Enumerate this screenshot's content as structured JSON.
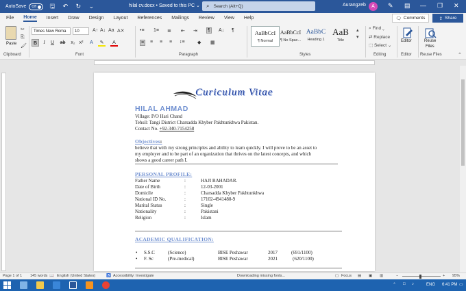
{
  "titlebar": {
    "autosave_label": "AutoSave",
    "autosave_state": "Off",
    "doc_title": "hilal cv.docx • Saved to this PC ⌄",
    "search_placeholder": "Search (Alt+Q)",
    "user_name": "Aurangzeb",
    "user_initial": "A",
    "accent": "#2b579a"
  },
  "tabs": [
    "File",
    "Home",
    "Insert",
    "Draw",
    "Design",
    "Layout",
    "References",
    "Mailings",
    "Review",
    "View",
    "Help"
  ],
  "active_tab": "Home",
  "actions": {
    "comments": "Comments",
    "share": "Share"
  },
  "ribbon": {
    "clipboard": {
      "paste": "Paste",
      "label": "Clipboard"
    },
    "font": {
      "name": "Times New Roma",
      "size": "10",
      "label": "Font"
    },
    "paragraph": {
      "label": "Paragraph"
    },
    "styles": {
      "label": "Styles",
      "items": [
        {
          "sample": "AaBbCcI",
          "name": "¶ Normal"
        },
        {
          "sample": "AaBbCcI",
          "name": "¶ No Spac..."
        },
        {
          "sample": "AaBbC",
          "name": "Heading 1"
        },
        {
          "sample": "AaB",
          "name": "Title"
        }
      ]
    },
    "editing": {
      "find": "Find",
      "replace": "Replace",
      "select": "Select",
      "label": "Editing"
    },
    "editor": {
      "button": "Editor",
      "label": "Editor"
    },
    "reuse": {
      "button_line1": "Reuse",
      "button_line2": "Files",
      "label": "Reuse Files"
    }
  },
  "document": {
    "heading_title": "Curiculum Vitae",
    "name": "HILAL AHMAD",
    "village": "Village: P/O Hari Chand",
    "tehsil": "Tehsil: Tangi District Charsadda Khyber Pakhtunkhwa Pakistan.",
    "contact_label": "Contact No. ",
    "contact_number": "+92-340-7154258",
    "objectives_heading": "Objectives",
    "objectives_colon": ":",
    "objectives_lines": [
      "believe that with my strong principles and ability to learn quickly. I will prove to be an asset to",
      "my employer and to be part of an organization that thrives on the latest concepts, and which",
      "shows a good career path I."
    ],
    "personal_heading": "PERSONAL PROFILE:",
    "personal": [
      {
        "label": "Father Name",
        "value": "HAJI BAHADAR."
      },
      {
        "label": "Date of Birth",
        "value": "12-03-2001"
      },
      {
        "label": "Domicile",
        "value": "Charsadda Khyber Pakhtunkhwa"
      },
      {
        "label": "National ID No.",
        "value": "17102-4941480-9"
      },
      {
        "label": "Marital Status",
        "value": "Single"
      },
      {
        "label": "Nationality",
        "value": "Pakistani"
      },
      {
        "label": "Religion",
        "value": "Islam"
      }
    ],
    "academic_heading": "ACADEMIC QUALIFICATION:",
    "academics": [
      {
        "degree": "S.S.C",
        "stream": "(Science)",
        "board": "BISE Peshawar",
        "year": "2017",
        "marks": "(691/1100)"
      },
      {
        "degree": "F. Sc",
        "stream": "(Pre-medical)",
        "board": "BISE Peshawar",
        "year": "2021",
        "marks": "(620/1100)"
      }
    ]
  },
  "statusbar": {
    "page": "Page 1 of 1",
    "words": "145 words",
    "language": "English (United States)",
    "accessibility": "Accessibility: Investigate",
    "downloading": "Downloading missing fonts...",
    "focus": "Focus",
    "zoom": "95%"
  },
  "taskbar": {
    "language": "ENG",
    "time": "6:41 PM"
  }
}
